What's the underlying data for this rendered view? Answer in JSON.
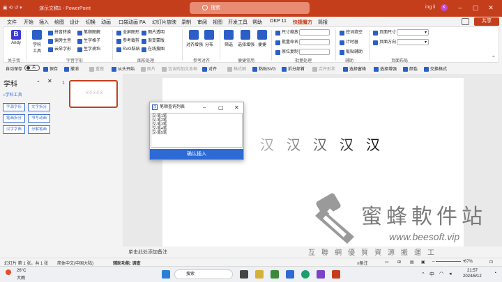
{
  "titlebar": {
    "doc": "演示文稿1 - PowerPoint",
    "search_placeholder": "搜索",
    "user": "ing li",
    "avatar_letter": "K"
  },
  "tabs": [
    "文件",
    "开始",
    "插入",
    "绘图",
    "设计",
    "切换",
    "动画",
    "口袋动画 PA",
    "幻灯片放映",
    "录制",
    "审阅",
    "视图",
    "开发工具",
    "帮助",
    "OKP 11",
    "快捷魔方",
    "简报"
  ],
  "active_tab": "快捷魔方",
  "share_label": "共享",
  "ribbon": {
    "andy": "Andy",
    "about": "关于我",
    "subject_tools": "学科\n工具",
    "zi": [
      "拼音转换",
      "偏旁主音",
      "云朵字形",
      "笔顺图解",
      "生字格子",
      "生字琥珀"
    ],
    "zi_group": "字音字形",
    "shape": [
      "全屏图形",
      "参考裁剪",
      "SVG粘贴",
      "图片透明",
      "渐变蒙版",
      "在线搜图"
    ],
    "shape_group": "图形处理",
    "align": [
      "对齐增强",
      "分布"
    ],
    "align_group": "参考对齐",
    "select": [
      "筛选",
      "选择增强",
      "便捷"
    ],
    "select_group": "便捷常用",
    "batch": [
      "尺寸缩放",
      "批量命名",
      "原位复制"
    ],
    "batch_group": "批量处理",
    "aux": [
      "控词填空",
      "计时器",
      "板贴辅助"
    ],
    "aux_group": "辅助",
    "page": [
      "页面尺寸",
      "页面方向"
    ],
    "page_group": "页面布局"
  },
  "qbar": {
    "autosave": "自动保存",
    "toggle": "关",
    "items": [
      "保存",
      "撤消",
      "重做",
      "从头开始",
      "图片",
      "包含附加文本框",
      "对齐",
      "格式刷",
      "粘贴SVG",
      "拆分部首",
      "合并形状",
      "选择窗格",
      "选择增强",
      "颜色",
      "交换格式"
    ]
  },
  "leftpane": {
    "title": "学科",
    "subtitle": "学科工具",
    "buttons": [
      "字源字形",
      "文字拆分",
      "笔画拆分",
      "书写动画",
      "汉字字典",
      "分解笔画"
    ]
  },
  "thumb_num": "1",
  "slide_chars": [
    "汉",
    "汉",
    "汉",
    "汉",
    "汉"
  ],
  "dialog": {
    "icon": "汉",
    "title": "笔顺查询列表",
    "items": [
      "汉-笔1笔",
      "汉-笔2笔",
      "汉-笔3笔",
      "汉-笔4笔",
      "汉-笔5笔"
    ],
    "ok": "确认插入"
  },
  "notes": "单击此处添加备注",
  "status": {
    "slide": "幻灯片 第 1 张，共 1 张",
    "lang": "简体中文(中国大陆)",
    "access": "辅助功能: 调查",
    "notes": "备注",
    "zoom": "67%"
  },
  "taskbar": {
    "temp": "26°C",
    "weather": "大雨",
    "search": "搜索",
    "time": "21:57",
    "date": "2024/6/12",
    "lang": "中"
  },
  "watermark": {
    "brand": "蜜蜂軟件站",
    "url": "www.beesoft.vip",
    "slogan": "互聯網優質資源搬運工"
  }
}
